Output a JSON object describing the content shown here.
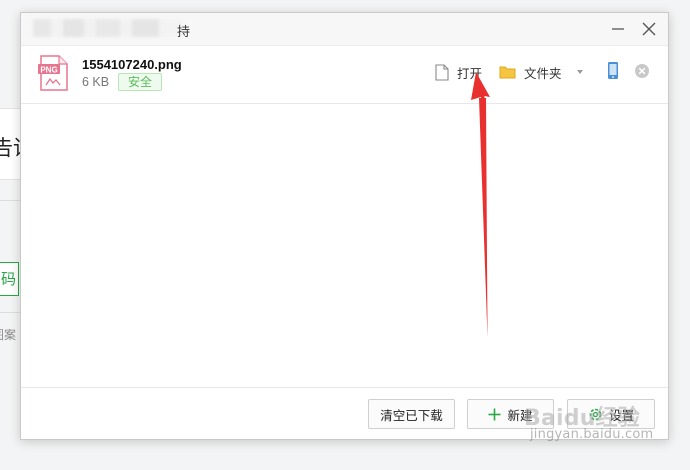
{
  "background": {
    "text_top": "告诉",
    "button_text": "码",
    "small_text": "图案"
  },
  "dialog": {
    "title_suffix": "持",
    "file": {
      "name": "1554107240.png",
      "size": "6 KB",
      "status": "安全",
      "icon_label": "PNG"
    },
    "actions": {
      "open_label": "打开",
      "folder_label": "文件夹"
    },
    "footer": {
      "clear_label": "清空已下载",
      "new_label": "新建",
      "settings_label": "设置"
    }
  },
  "watermark": {
    "logo": "Baidu经验",
    "url": "jingyan.baidu.com"
  },
  "colors": {
    "accent_green": "#27a844",
    "safe_green": "#5bbd5b",
    "arrow_red": "#e8312f",
    "png_pink": "#e8758f"
  },
  "icons": [
    "minimize-icon",
    "close-icon",
    "png-file-icon",
    "document-icon",
    "folder-icon",
    "caret-down-icon",
    "phone-icon",
    "remove-icon",
    "plus-icon",
    "settings-icon"
  ]
}
